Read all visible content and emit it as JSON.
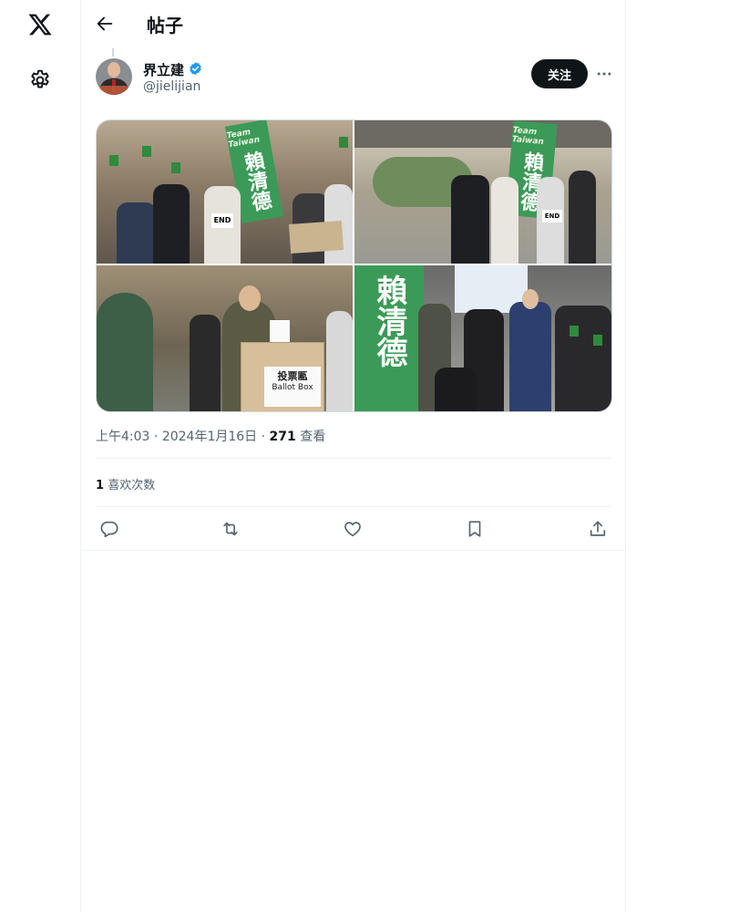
{
  "header": {
    "title": "帖子",
    "back_icon": "arrow-left-icon"
  },
  "author": {
    "display_name": "界立建",
    "handle": "@jielijian",
    "verified": true,
    "verified_color": "#1d9bf0"
  },
  "follow_label": "关注",
  "tweet": {
    "photos": [
      {
        "banner_team": "Team Taiwan",
        "banner_text": "賴清德",
        "sign_text": "END"
      },
      {
        "banner_team": "Team Taiwan",
        "banner_text": "賴清德",
        "sign_text": "END"
      },
      {
        "box_label_cn": "投票匭",
        "box_label_en": "Ballot Box"
      },
      {
        "banner_text": "賴清德"
      }
    ],
    "time": "上午4:03",
    "date": "2024年1月16日",
    "views_count": "271",
    "views_label": "查看",
    "likes_count": "1",
    "likes_label": "喜欢次数"
  },
  "actions": [
    "reply-icon",
    "retweet-icon",
    "like-icon",
    "bookmark-icon",
    "share-icon"
  ],
  "colors": {
    "text": "#0f1419",
    "secondary": "#536471",
    "border": "#eff3f4",
    "banner_green": "#3b9a57"
  }
}
